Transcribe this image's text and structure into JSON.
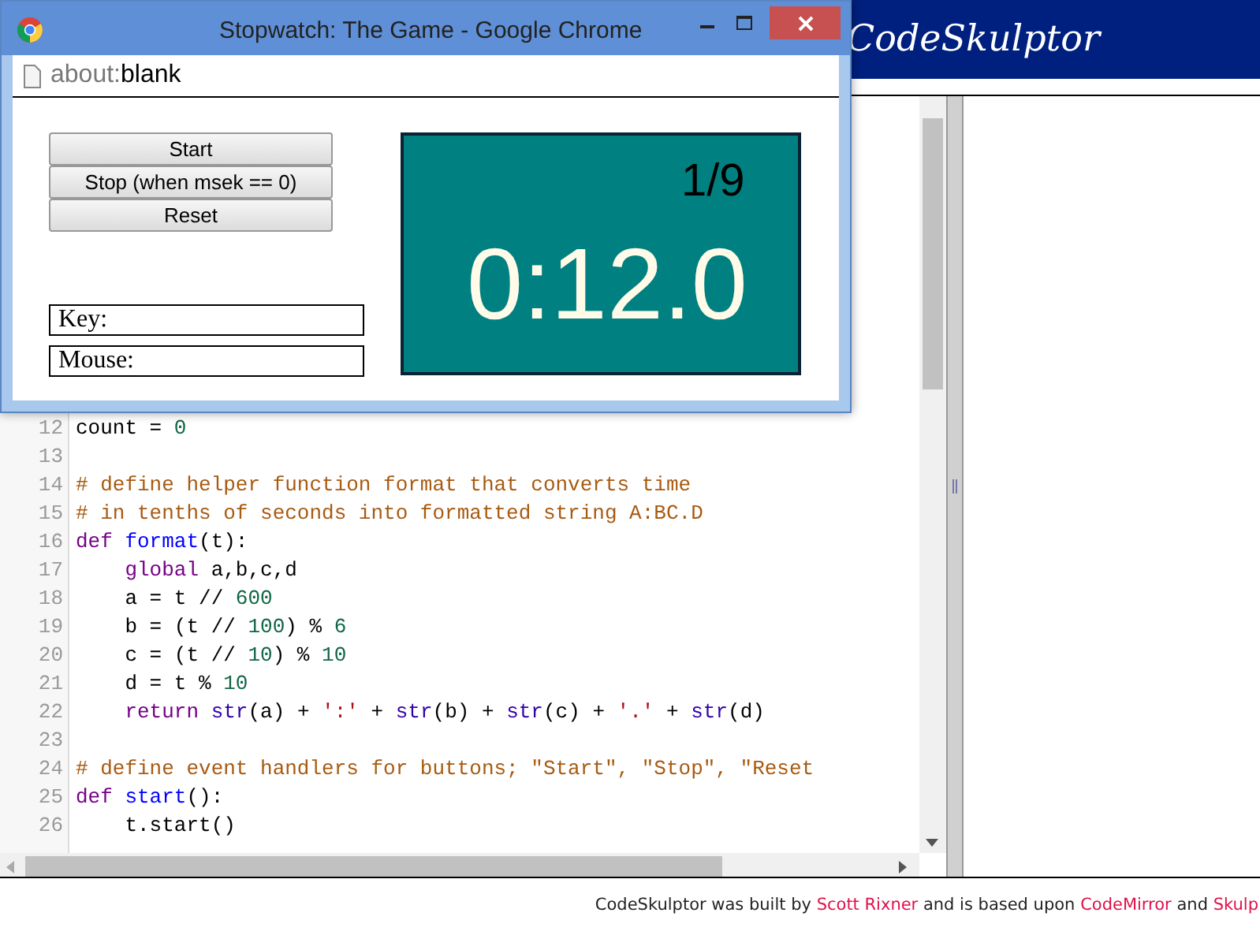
{
  "site": {
    "logo": "CodeSkulptor"
  },
  "window": {
    "title": "Stopwatch: The Game - Google Chrome",
    "address_scheme": "about:",
    "address_rest": "blank"
  },
  "controls": {
    "buttons": [
      "Start",
      "Stop (when msek == 0)",
      "Reset"
    ],
    "key_label": "Key:",
    "mouse_label": "Mouse:"
  },
  "canvas": {
    "score": "1/9",
    "time": "0:12.0"
  },
  "editor": {
    "lines": [
      {
        "number": "12",
        "tokens": [
          {
            "kind": "plain",
            "text": "count = "
          },
          {
            "kind": "number",
            "text": "0"
          }
        ]
      },
      {
        "number": "13"
      },
      {
        "number": "14",
        "tokens": [
          {
            "kind": "comment",
            "text": "# define helper function format that converts time"
          }
        ]
      },
      {
        "number": "15",
        "tokens": [
          {
            "kind": "comment",
            "text": "# in tenths of seconds into formatted string A:BC.D"
          }
        ]
      },
      {
        "number": "16",
        "tokens": [
          {
            "kind": "keyword",
            "text": "def"
          },
          {
            "kind": "defname",
            "text": " format"
          },
          {
            "kind": "plain",
            "text": "(t):"
          }
        ]
      },
      {
        "number": "17",
        "tokens": [
          {
            "kind": "keyword",
            "text": "    global"
          },
          {
            "kind": "plain",
            "text": " a,b,c,d"
          }
        ]
      },
      {
        "number": "18",
        "tokens": [
          {
            "kind": "plain",
            "text": "    a = t // "
          },
          {
            "kind": "number",
            "text": "600"
          }
        ]
      },
      {
        "number": "19",
        "tokens": [
          {
            "kind": "plain",
            "text": "    b = (t // "
          },
          {
            "kind": "number",
            "text": "100"
          },
          {
            "kind": "plain",
            "text": ") % "
          },
          {
            "kind": "number",
            "text": "6"
          }
        ]
      },
      {
        "number": "20",
        "tokens": [
          {
            "kind": "plain",
            "text": "    c = (t // "
          },
          {
            "kind": "number",
            "text": "10"
          },
          {
            "kind": "plain",
            "text": ") % "
          },
          {
            "kind": "number",
            "text": "10"
          }
        ]
      },
      {
        "number": "21",
        "tokens": [
          {
            "kind": "plain",
            "text": "    d = t % "
          },
          {
            "kind": "number",
            "text": "10"
          }
        ]
      },
      {
        "number": "22",
        "tokens": [
          {
            "kind": "keyword",
            "text": "    return"
          },
          {
            "kind": "builtin",
            "text": " str"
          },
          {
            "kind": "plain",
            "text": "(a) + "
          },
          {
            "kind": "string",
            "text": "':'"
          },
          {
            "kind": "plain",
            "text": " + "
          },
          {
            "kind": "builtin",
            "text": "str"
          },
          {
            "kind": "plain",
            "text": "(b) + "
          },
          {
            "kind": "builtin",
            "text": "str"
          },
          {
            "kind": "plain",
            "text": "(c) + "
          },
          {
            "kind": "string",
            "text": "'.'"
          },
          {
            "kind": "plain",
            "text": " + "
          },
          {
            "kind": "builtin",
            "text": "str"
          },
          {
            "kind": "plain",
            "text": "(d)"
          }
        ]
      },
      {
        "number": "23"
      },
      {
        "number": "24",
        "tokens": [
          {
            "kind": "comment",
            "text": "# define event handlers for buttons; \"Start\", \"Stop\", \"Reset"
          }
        ]
      },
      {
        "number": "25",
        "tokens": [
          {
            "kind": "keyword",
            "text": "def"
          },
          {
            "kind": "defname",
            "text": " start"
          },
          {
            "kind": "plain",
            "text": "():"
          }
        ]
      },
      {
        "number": "26",
        "tokens": [
          {
            "kind": "plain",
            "text": "    t.start()"
          }
        ]
      }
    ]
  },
  "footer": {
    "parts": [
      {
        "kind": "text",
        "text": "CodeSkulptor was built by "
      },
      {
        "kind": "link",
        "text": "Scott Rixner"
      },
      {
        "kind": "text",
        "text": " and is based upon "
      },
      {
        "kind": "link",
        "text": "CodeMirror"
      },
      {
        "kind": "text",
        "text": " and "
      },
      {
        "kind": "link",
        "text": "Skulp"
      }
    ]
  }
}
